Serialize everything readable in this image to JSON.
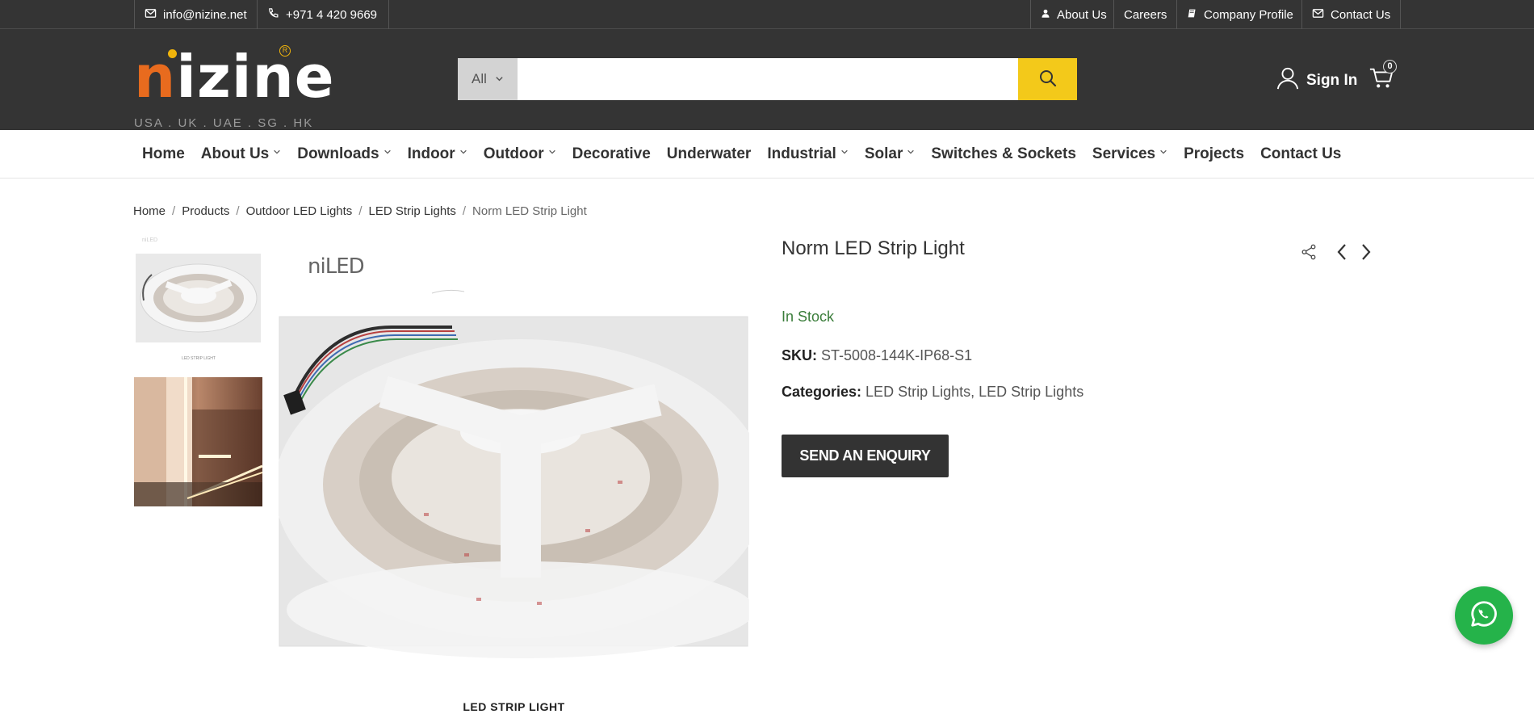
{
  "topbar": {
    "email": "info@nizine.net",
    "phone": "+971 4 420 9669",
    "links": [
      "About Us",
      "Careers",
      "Company Profile",
      "Contact Us"
    ]
  },
  "logo": {
    "first_letter": "n",
    "rest": "izine",
    "registered": "R",
    "tagline": "USA . UK . UAE . SG . HK"
  },
  "search": {
    "category": "All",
    "placeholder": ""
  },
  "account": {
    "signin_label": "Sign In",
    "cart_count": "0"
  },
  "nav": {
    "items": [
      {
        "label": "Home",
        "dropdown": false
      },
      {
        "label": "About Us",
        "dropdown": true
      },
      {
        "label": "Downloads",
        "dropdown": true
      },
      {
        "label": "Indoor",
        "dropdown": true
      },
      {
        "label": "Outdoor",
        "dropdown": true
      },
      {
        "label": "Decorative",
        "dropdown": false
      },
      {
        "label": "Underwater",
        "dropdown": false
      },
      {
        "label": "Industrial",
        "dropdown": true
      },
      {
        "label": "Solar",
        "dropdown": true
      },
      {
        "label": "Switches & Sockets",
        "dropdown": false
      },
      {
        "label": "Services",
        "dropdown": true
      },
      {
        "label": "Projects",
        "dropdown": false
      },
      {
        "label": "Contact Us",
        "dropdown": false
      }
    ]
  },
  "breadcrumb": [
    "Home",
    "Products",
    "Outdoor LED Lights",
    "LED Strip Lights",
    "Norm LED Strip Light"
  ],
  "gallery": {
    "brand_text": "niLED",
    "caption": "LED STRIP LIGHT"
  },
  "product": {
    "title": "Norm LED Strip Light",
    "stock": "In Stock",
    "sku_label": "SKU:",
    "sku_value": "ST-5008-144K-IP68-S1",
    "categories_label": "Categories:",
    "categories": [
      "LED Strip Lights",
      "LED Strip Lights"
    ],
    "enquiry_button": "SEND AN ENQUIRY"
  },
  "colors": {
    "header_bg": "#343434",
    "accent_yellow": "#f3c91a",
    "logo_orange": "#e86b1e",
    "stock_green": "#3a7d3a",
    "whatsapp_green": "#25b34a"
  },
  "icons": [
    "envelope-icon",
    "phone-icon",
    "user-icon",
    "book-icon",
    "search-icon",
    "cart-icon",
    "share-icon",
    "chevron-left-icon",
    "chevron-right-icon",
    "whatsapp-icon"
  ]
}
